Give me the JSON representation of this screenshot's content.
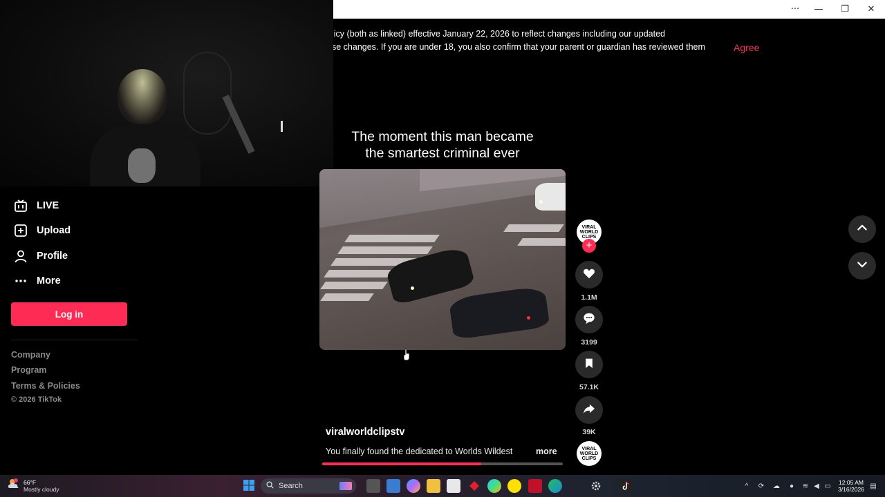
{
  "window": {
    "controls": [
      "···",
      "—",
      "❐",
      "✕"
    ]
  },
  "banner": {
    "line1": "licy (both as linked) effective January 22, 2026 to reflect changes including our updated",
    "line2": "se changes. If you are under 18, you also confirm that your parent or guardian has reviewed them",
    "agree_label": "Agree"
  },
  "sidebar": {
    "items": [
      {
        "label": "LIVE",
        "icon": "live-icon"
      },
      {
        "label": "Upload",
        "icon": "upload-icon"
      },
      {
        "label": "Profile",
        "icon": "profile-icon"
      },
      {
        "label": "More",
        "icon": "more-icon"
      }
    ],
    "login_label": "Log in",
    "footer_links": [
      "Company",
      "Program",
      "Terms & Policies"
    ],
    "copyright": "© 2026 TikTok"
  },
  "video": {
    "caption_line1": "The moment this man became",
    "caption_line2": "the smartest criminal ever",
    "author": "viralworldclipstv",
    "description": "You finally found the dedicated to Worlds Wildest",
    "more_label": "more",
    "progress": 0.66,
    "avatar_text": [
      "VIRAL",
      "WORLD",
      "CLIPS"
    ],
    "follow_symbol": "+"
  },
  "actions": {
    "likes": "1.1M",
    "comments": "3199",
    "saves": "57.1K",
    "shares": "39K"
  },
  "taskbar": {
    "weather_temp": "66°F",
    "weather_cond": "Mostly cloudy",
    "search_label": "Search",
    "time": "12:05 AM",
    "date": "3/16/2026"
  },
  "colors": {
    "accent": "#fe2c55",
    "background": "#000000"
  }
}
